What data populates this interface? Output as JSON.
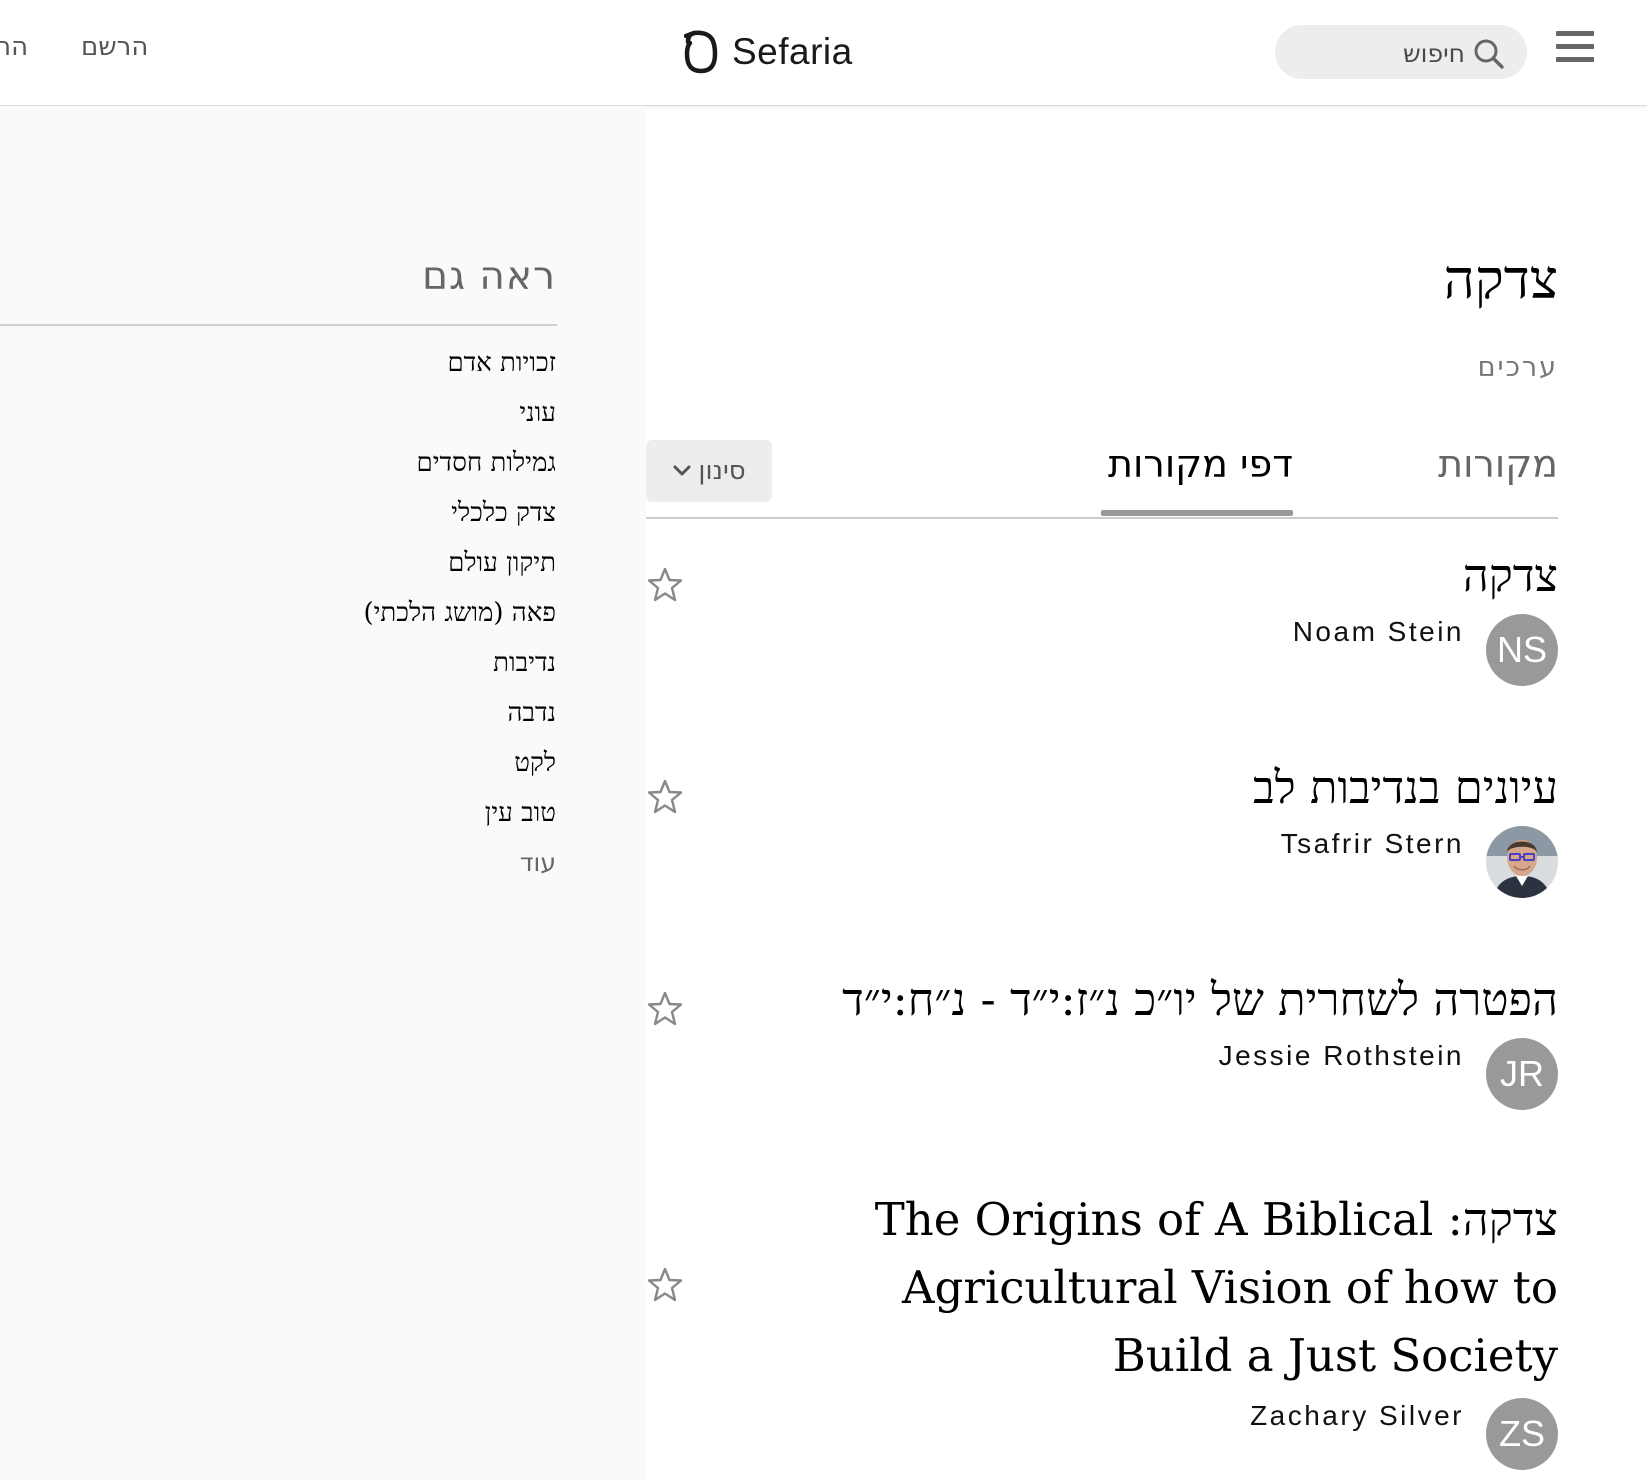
{
  "header": {
    "nav_left_partial": "הת",
    "signup": "הרשם",
    "logo_text": "Sefaria",
    "search_placeholder": "חיפוש"
  },
  "sidebar": {
    "title": "ראה גם",
    "items": [
      "זכויות אדם",
      "עוני",
      "גמילות חסדים",
      "צדק כלכלי",
      "תיקון עולם",
      "פאה (מושג הלכתי)",
      "נדיבות",
      "נדבה",
      "לקט",
      "טוב עין"
    ],
    "more": "עוד"
  },
  "main": {
    "title": "צדקה",
    "subtitle": "ערכים",
    "tabs": [
      {
        "label": "מקורות"
      },
      {
        "label": "דפי מקורות"
      }
    ],
    "filter_label": "סינון",
    "sheets": [
      {
        "title": "צדקה",
        "author": "Noam Stein",
        "initials": "NS"
      },
      {
        "title": "עיונים בנדיבות לב",
        "author": "Tsafrir Stern",
        "initials": ""
      },
      {
        "title": "הפטרה לשחרית של יו״כ נ״ז:י״ד - נ״ח:י״ד",
        "author": "Jessie Rothstein",
        "initials": "JR"
      },
      {
        "title": "צדקה: The Origins of A Biblical Agricultural Vision of how to Build a Just Society",
        "author": "Zachary Silver",
        "initials": "ZS"
      }
    ]
  },
  "colors": {
    "avatar_bg": "#999999",
    "tab_underline": "#999999",
    "sidebar_bg": "#fafafa"
  }
}
